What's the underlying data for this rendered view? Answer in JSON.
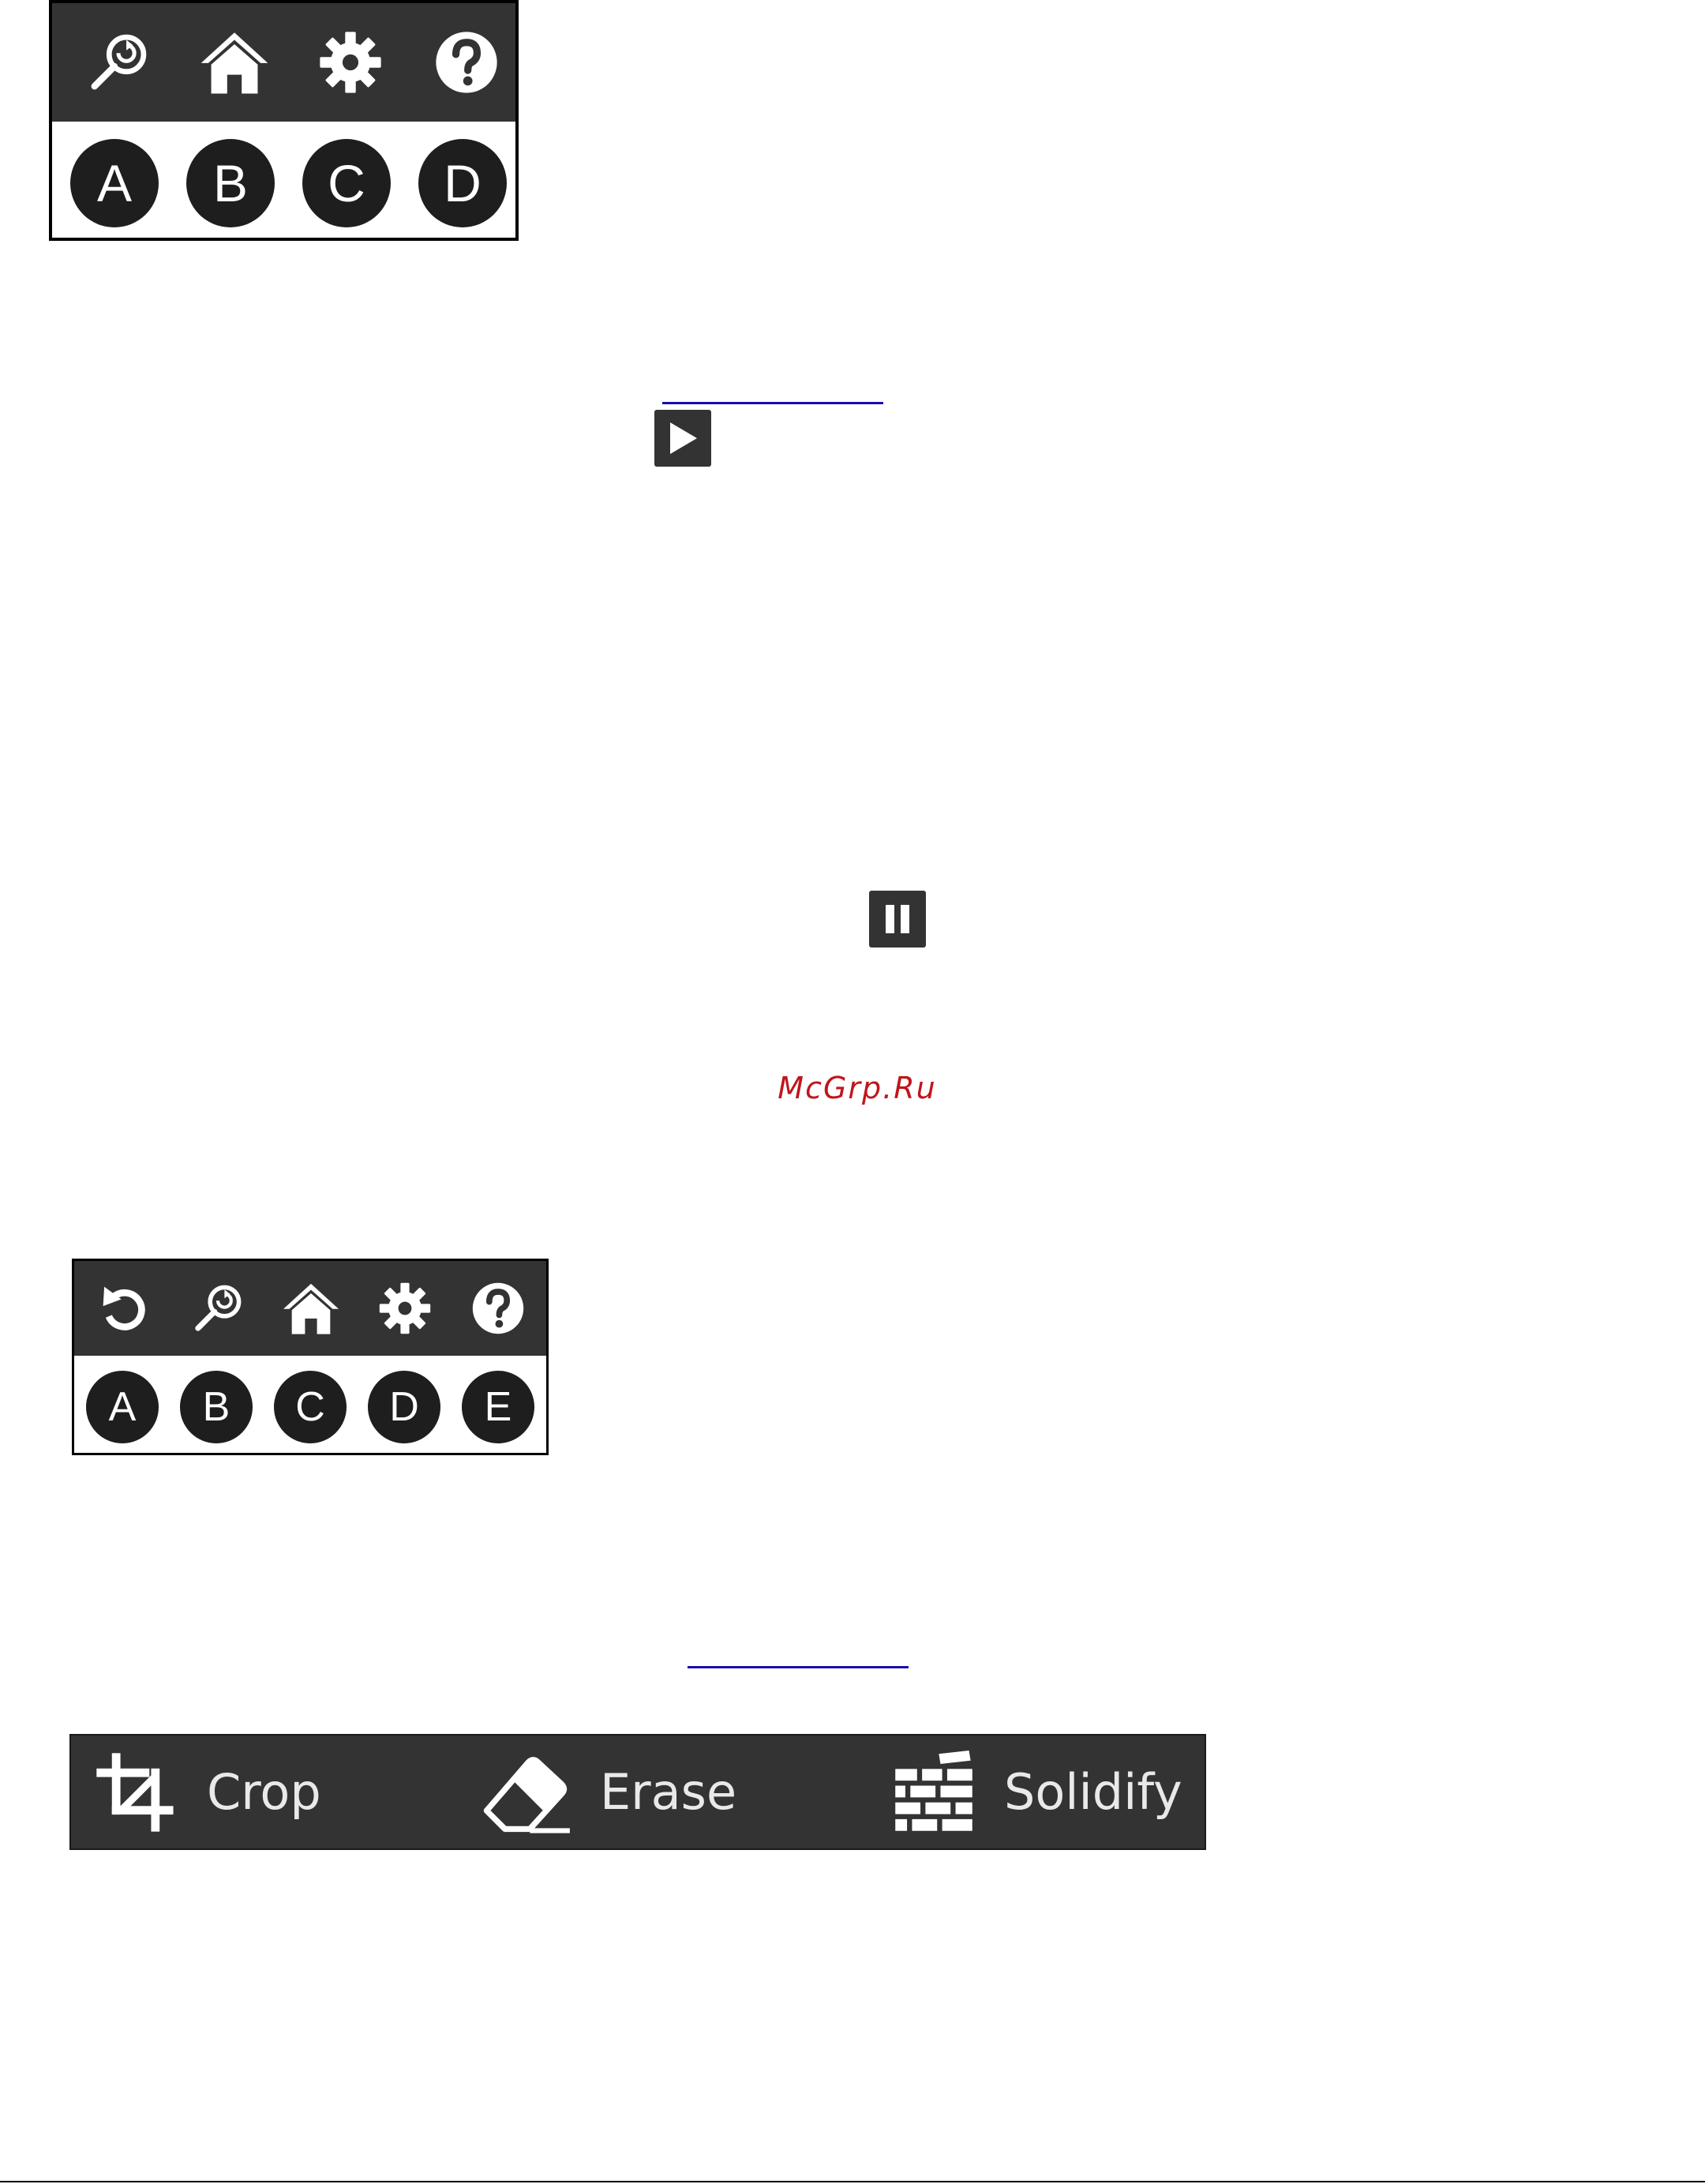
{
  "panel_top": {
    "tools": [
      {
        "icon": "zoom-reset-icon",
        "name": "zoom-reset"
      },
      {
        "icon": "home-icon",
        "name": "home"
      },
      {
        "icon": "gear-icon",
        "name": "settings"
      },
      {
        "icon": "help-icon",
        "name": "help"
      }
    ],
    "letters": [
      "A",
      "B",
      "C",
      "D"
    ]
  },
  "media": {
    "play_icon": "play-icon",
    "pause_icon": "pause-icon"
  },
  "watermark": "McGrp.Ru",
  "panel_bottom": {
    "tools": [
      {
        "icon": "undo-icon",
        "name": "undo"
      },
      {
        "icon": "zoom-reset-icon",
        "name": "zoom-reset"
      },
      {
        "icon": "home-icon",
        "name": "home"
      },
      {
        "icon": "gear-icon",
        "name": "settings"
      },
      {
        "icon": "help-icon",
        "name": "help"
      }
    ],
    "letters": [
      "A",
      "B",
      "C",
      "D",
      "E"
    ]
  },
  "toolbar": {
    "crop_label": "Crop",
    "erase_label": "Erase",
    "solidify_label": "Solidify"
  },
  "colors": {
    "panel_dark": "#333333",
    "circle_fill": "#1e1e1e",
    "watermark": "#c0151b",
    "link": "#1a0dab"
  }
}
